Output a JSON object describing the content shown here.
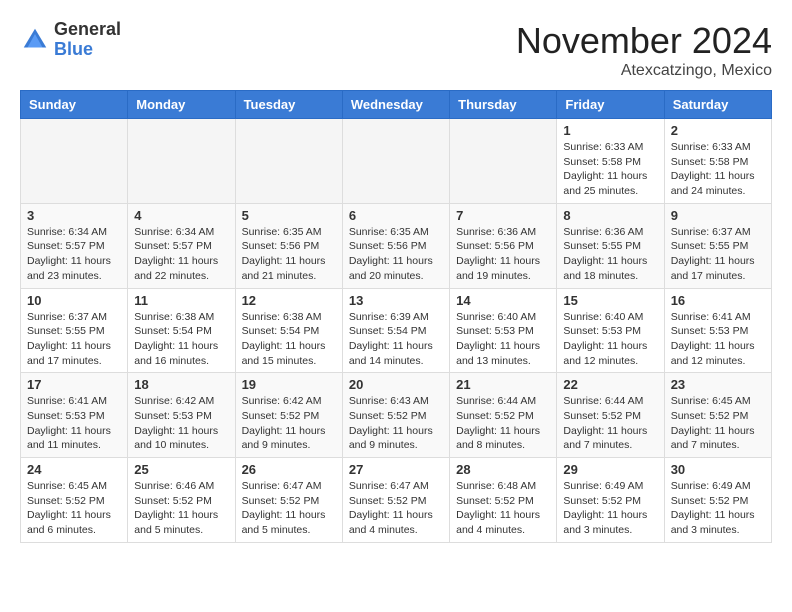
{
  "header": {
    "logo_general": "General",
    "logo_blue": "Blue",
    "month_title": "November 2024",
    "location": "Atexcatzingo, Mexico"
  },
  "days_of_week": [
    "Sunday",
    "Monday",
    "Tuesday",
    "Wednesday",
    "Thursday",
    "Friday",
    "Saturday"
  ],
  "weeks": [
    {
      "shaded": false,
      "days": [
        {
          "date": "",
          "empty": true
        },
        {
          "date": "",
          "empty": true
        },
        {
          "date": "",
          "empty": true
        },
        {
          "date": "",
          "empty": true
        },
        {
          "date": "",
          "empty": true
        },
        {
          "date": "1",
          "sunrise": "Sunrise: 6:33 AM",
          "sunset": "Sunset: 5:58 PM",
          "daylight": "Daylight: 11 hours and 25 minutes."
        },
        {
          "date": "2",
          "sunrise": "Sunrise: 6:33 AM",
          "sunset": "Sunset: 5:58 PM",
          "daylight": "Daylight: 11 hours and 24 minutes."
        }
      ]
    },
    {
      "shaded": true,
      "days": [
        {
          "date": "3",
          "sunrise": "Sunrise: 6:34 AM",
          "sunset": "Sunset: 5:57 PM",
          "daylight": "Daylight: 11 hours and 23 minutes."
        },
        {
          "date": "4",
          "sunrise": "Sunrise: 6:34 AM",
          "sunset": "Sunset: 5:57 PM",
          "daylight": "Daylight: 11 hours and 22 minutes."
        },
        {
          "date": "5",
          "sunrise": "Sunrise: 6:35 AM",
          "sunset": "Sunset: 5:56 PM",
          "daylight": "Daylight: 11 hours and 21 minutes."
        },
        {
          "date": "6",
          "sunrise": "Sunrise: 6:35 AM",
          "sunset": "Sunset: 5:56 PM",
          "daylight": "Daylight: 11 hours and 20 minutes."
        },
        {
          "date": "7",
          "sunrise": "Sunrise: 6:36 AM",
          "sunset": "Sunset: 5:56 PM",
          "daylight": "Daylight: 11 hours and 19 minutes."
        },
        {
          "date": "8",
          "sunrise": "Sunrise: 6:36 AM",
          "sunset": "Sunset: 5:55 PM",
          "daylight": "Daylight: 11 hours and 18 minutes."
        },
        {
          "date": "9",
          "sunrise": "Sunrise: 6:37 AM",
          "sunset": "Sunset: 5:55 PM",
          "daylight": "Daylight: 11 hours and 17 minutes."
        }
      ]
    },
    {
      "shaded": false,
      "days": [
        {
          "date": "10",
          "sunrise": "Sunrise: 6:37 AM",
          "sunset": "Sunset: 5:55 PM",
          "daylight": "Daylight: 11 hours and 17 minutes."
        },
        {
          "date": "11",
          "sunrise": "Sunrise: 6:38 AM",
          "sunset": "Sunset: 5:54 PM",
          "daylight": "Daylight: 11 hours and 16 minutes."
        },
        {
          "date": "12",
          "sunrise": "Sunrise: 6:38 AM",
          "sunset": "Sunset: 5:54 PM",
          "daylight": "Daylight: 11 hours and 15 minutes."
        },
        {
          "date": "13",
          "sunrise": "Sunrise: 6:39 AM",
          "sunset": "Sunset: 5:54 PM",
          "daylight": "Daylight: 11 hours and 14 minutes."
        },
        {
          "date": "14",
          "sunrise": "Sunrise: 6:40 AM",
          "sunset": "Sunset: 5:53 PM",
          "daylight": "Daylight: 11 hours and 13 minutes."
        },
        {
          "date": "15",
          "sunrise": "Sunrise: 6:40 AM",
          "sunset": "Sunset: 5:53 PM",
          "daylight": "Daylight: 11 hours and 12 minutes."
        },
        {
          "date": "16",
          "sunrise": "Sunrise: 6:41 AM",
          "sunset": "Sunset: 5:53 PM",
          "daylight": "Daylight: 11 hours and 12 minutes."
        }
      ]
    },
    {
      "shaded": true,
      "days": [
        {
          "date": "17",
          "sunrise": "Sunrise: 6:41 AM",
          "sunset": "Sunset: 5:53 PM",
          "daylight": "Daylight: 11 hours and 11 minutes."
        },
        {
          "date": "18",
          "sunrise": "Sunrise: 6:42 AM",
          "sunset": "Sunset: 5:53 PM",
          "daylight": "Daylight: 11 hours and 10 minutes."
        },
        {
          "date": "19",
          "sunrise": "Sunrise: 6:42 AM",
          "sunset": "Sunset: 5:52 PM",
          "daylight": "Daylight: 11 hours and 9 minutes."
        },
        {
          "date": "20",
          "sunrise": "Sunrise: 6:43 AM",
          "sunset": "Sunset: 5:52 PM",
          "daylight": "Daylight: 11 hours and 9 minutes."
        },
        {
          "date": "21",
          "sunrise": "Sunrise: 6:44 AM",
          "sunset": "Sunset: 5:52 PM",
          "daylight": "Daylight: 11 hours and 8 minutes."
        },
        {
          "date": "22",
          "sunrise": "Sunrise: 6:44 AM",
          "sunset": "Sunset: 5:52 PM",
          "daylight": "Daylight: 11 hours and 7 minutes."
        },
        {
          "date": "23",
          "sunrise": "Sunrise: 6:45 AM",
          "sunset": "Sunset: 5:52 PM",
          "daylight": "Daylight: 11 hours and 7 minutes."
        }
      ]
    },
    {
      "shaded": false,
      "days": [
        {
          "date": "24",
          "sunrise": "Sunrise: 6:45 AM",
          "sunset": "Sunset: 5:52 PM",
          "daylight": "Daylight: 11 hours and 6 minutes."
        },
        {
          "date": "25",
          "sunrise": "Sunrise: 6:46 AM",
          "sunset": "Sunset: 5:52 PM",
          "daylight": "Daylight: 11 hours and 5 minutes."
        },
        {
          "date": "26",
          "sunrise": "Sunrise: 6:47 AM",
          "sunset": "Sunset: 5:52 PM",
          "daylight": "Daylight: 11 hours and 5 minutes."
        },
        {
          "date": "27",
          "sunrise": "Sunrise: 6:47 AM",
          "sunset": "Sunset: 5:52 PM",
          "daylight": "Daylight: 11 hours and 4 minutes."
        },
        {
          "date": "28",
          "sunrise": "Sunrise: 6:48 AM",
          "sunset": "Sunset: 5:52 PM",
          "daylight": "Daylight: 11 hours and 4 minutes."
        },
        {
          "date": "29",
          "sunrise": "Sunrise: 6:49 AM",
          "sunset": "Sunset: 5:52 PM",
          "daylight": "Daylight: 11 hours and 3 minutes."
        },
        {
          "date": "30",
          "sunrise": "Sunrise: 6:49 AM",
          "sunset": "Sunset: 5:52 PM",
          "daylight": "Daylight: 11 hours and 3 minutes."
        }
      ]
    }
  ]
}
